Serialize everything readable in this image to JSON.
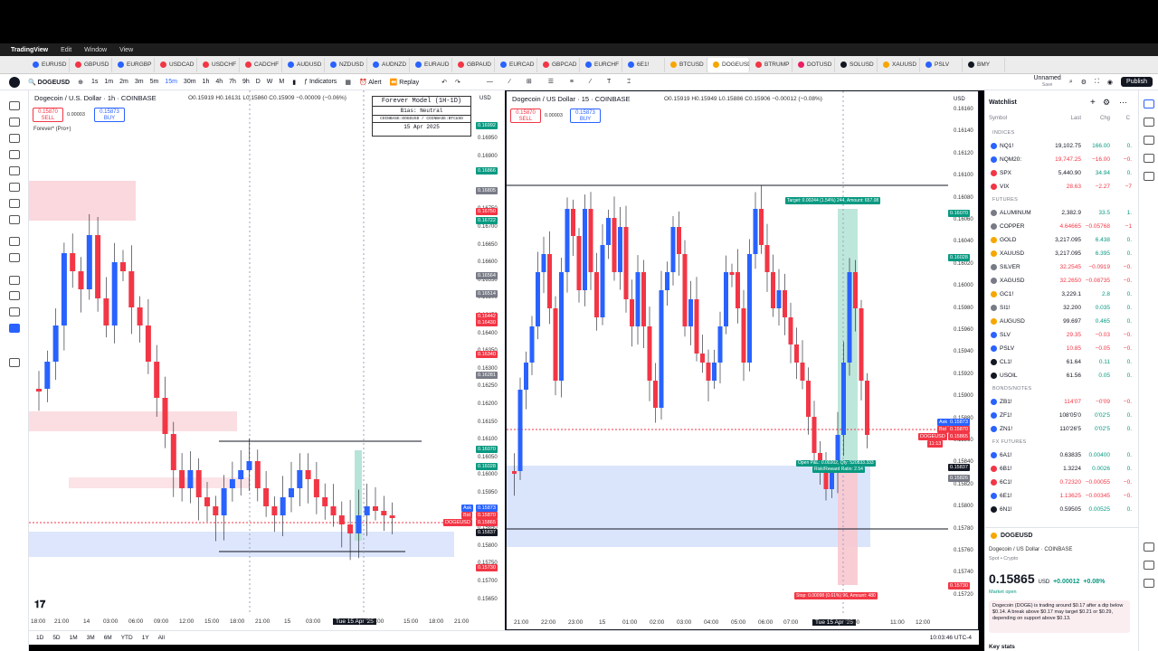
{
  "menubar": {
    "app": "TradingView",
    "items": [
      "Edit",
      "Window",
      "View"
    ]
  },
  "tabs": [
    "EURUSD",
    "GBPUSD",
    "EURGBP",
    "USDCAD",
    "USDCHF",
    "CADCHF",
    "AUDUSD",
    "NZDUSD",
    "AUDNZD",
    "EURAUD",
    "GBPAUD",
    "EURCAD",
    "GBPCAD",
    "EURCHF",
    "6E1!",
    "BTCUSD",
    "DOGEUSD",
    "BTRUMP",
    "DOTUSD",
    "SOLUSD",
    "XAUUSD",
    "PSLV",
    "BMY"
  ],
  "active_tab": "DOG",
  "toolbar": {
    "symbol": "DOGEUSD",
    "intervals": [
      "1s",
      "1m",
      "2m",
      "3m",
      "5m",
      "15m",
      "30m",
      "1h",
      "4h",
      "7h",
      "9h",
      "D",
      "W",
      "M"
    ],
    "selected_interval": "15m",
    "indicators": "Indicators",
    "alert": "Alert",
    "replay": "Replay",
    "layout_name": "Unnamed",
    "layout_sub": "Save",
    "publish": "Publish"
  },
  "left_pane": {
    "title": "Dogecoin / U.S. Dollar · 1h · COINBASE",
    "ohlc": "O0.15919 H0.16131 L0.15860 C0.15909 −0.00009 (−0.06%)",
    "sell_price": "0.15870",
    "sell_label": "SELL",
    "buy_price": "0.15873",
    "buy_label": "BUY",
    "qty": "0.00003",
    "indicator_label": "Forever* (Pro+)",
    "forever_box": {
      "title": "Forever Model (1H-1D)",
      "bias": "Bias: Neutral",
      "pair": "COINBASE:DOGEUSD / COINBASE:BTCUSD",
      "date": "15 Apr 2025"
    },
    "currency": "USD",
    "price_labels": [
      "0.16950",
      "0.16900",
      "0.16850",
      "0.16800",
      "0.16750",
      "0.16700",
      "0.16650",
      "0.16600",
      "0.16550",
      "0.16500",
      "0.16450",
      "0.16400",
      "0.16350",
      "0.16300",
      "0.16250",
      "0.16200",
      "0.16150",
      "0.16100",
      "0.16050",
      "0.16000",
      "0.15950",
      "0.15900",
      "0.15850",
      "0.15800",
      "0.15750",
      "0.15700",
      "0.15650"
    ],
    "price_tags": [
      {
        "text": "0.16992",
        "color": "#089981"
      },
      {
        "text": "0.16866",
        "color": "#089981"
      },
      {
        "text": "0.16805",
        "color": "#787b86"
      },
      {
        "text": "0.16750",
        "color": "#f23645"
      },
      {
        "text": "0.16722",
        "color": "#089981"
      },
      {
        "text": "0.16564",
        "color": "#787b86"
      },
      {
        "text": "0.16514",
        "color": "#787b86"
      },
      {
        "text": "0.16442",
        "color": "#f23645"
      },
      {
        "text": "0.16430",
        "color": "#f23645"
      },
      {
        "text": "0.16340",
        "color": "#f23645"
      },
      {
        "text": "0.16281",
        "color": "#787b86"
      },
      {
        "text": "0.16070",
        "color": "#089981"
      },
      {
        "text": "0.16028",
        "color": "#089981"
      },
      {
        "text": "0.15873",
        "color": "#2962ff"
      },
      {
        "text": "0.15870",
        "color": "#f23645"
      },
      {
        "text": "0.15865",
        "color": "#f23645"
      },
      {
        "text": "0.15837",
        "color": "#131722"
      },
      {
        "text": "0.15730",
        "color": "#f23645"
      }
    ],
    "ask_label": "Ask",
    "bid_label": "Bid",
    "sym_label": "DOGEUSD",
    "time_labels": [
      "18:00",
      "21:00",
      "14",
      "03:00",
      "06:00",
      "09:00",
      "12:00",
      "15:00",
      "18:00",
      "21:00",
      "15",
      "03:00",
      "Tue 15 Apr '25",
      "09:00",
      "15:00",
      "18:00",
      "21:00"
    ]
  },
  "right_pane": {
    "title": "Dogecoin / US Dollar · 15 · COINBASE",
    "ohlc": "O0.15919 H0.15949 L0.15886 C0.15906 −0.00012 (−0.08%)",
    "sell_price": "0.15870",
    "sell_label": "SELL",
    "buy_price": "0.15873",
    "buy_label": "BUY",
    "qty": "0.00003",
    "currency": "USD",
    "price_labels": [
      "0.16160",
      "0.16140",
      "0.16120",
      "0.16100",
      "0.16080",
      "0.16060",
      "0.16040",
      "0.16020",
      "0.16000",
      "0.15980",
      "0.15960",
      "0.15940",
      "0.15920",
      "0.15900",
      "0.15880",
      "0.15860",
      "0.15840",
      "0.15820",
      "0.15800",
      "0.15780",
      "0.15760",
      "0.15740",
      "0.15720"
    ],
    "target_label": "Target: 0.00244 (1.54%) 244, Amount: 657.08",
    "open_label": "Open P&L: 0.00202, Qty: 520833.333",
    "risk_label": "Risk/Reward Ratio: 2.54",
    "stop_label": "Stop: 0.00098 (0.61%) 96, Amount: 480",
    "price_tags": [
      {
        "text": "0.16070",
        "color": "#089981"
      },
      {
        "text": "0.16028",
        "color": "#089981"
      },
      {
        "text": "0.15873",
        "color": "#2962ff"
      },
      {
        "text": "0.15870",
        "color": "#f23645"
      },
      {
        "text": "0.15865",
        "color": "#f23645"
      },
      {
        "text": "0.15837",
        "color": "#131722"
      },
      {
        "text": "0.15826",
        "color": "#787b86"
      },
      {
        "text": "0.15730",
        "color": "#f23645"
      }
    ],
    "ask_label": "Ask",
    "bid_label": "Bid",
    "sym_label": "DOGEUSD",
    "countdown": "11:13",
    "time_labels": [
      "21:00",
      "22:00",
      "23:00",
      "15",
      "01:00",
      "02:00",
      "03:00",
      "04:00",
      "05:00",
      "06:00",
      "07:00",
      "Tue 15 Apr '25",
      "09:00",
      "11:00",
      "12:00"
    ]
  },
  "bottom": {
    "ranges": [
      "1D",
      "5D",
      "1M",
      "3M",
      "6M",
      "YTD",
      "1Y",
      "All"
    ],
    "clock": "10:03:46 UTC-4"
  },
  "watchlist": {
    "title": "Watchlist",
    "headers": {
      "symbol": "Symbol",
      "last": "Last",
      "chg": "Chg",
      "pct": "C"
    },
    "sections": [
      {
        "name": "INDICES",
        "rows": [
          {
            "sym": "NQ1!",
            "last": "19,102.75",
            "chg": "166.00",
            "pct": "0.",
            "dir": "up",
            "color": "#2962ff"
          },
          {
            "sym": "NQM20:",
            "last": "19,747.25",
            "chg": "−16.00",
            "pct": "−0.",
            "dir": "down",
            "color": "#2962ff"
          },
          {
            "sym": "SPX",
            "last": "5,440.90",
            "chg": "34.94",
            "pct": "0.",
            "dir": "up",
            "color": "#f23645"
          },
          {
            "sym": "VIX",
            "last": "28.63",
            "chg": "−2.27",
            "pct": "−7",
            "dir": "down",
            "color": "#f23645"
          }
        ]
      },
      {
        "name": "FUTURES",
        "rows": [
          {
            "sym": "ALUMINUM",
            "last": "2,382.9",
            "chg": "33.5",
            "pct": "1.",
            "dir": "up",
            "color": "#787b86"
          },
          {
            "sym": "COPPER",
            "last": "4.64665",
            "chg": "−0.05768",
            "pct": "−1",
            "dir": "down",
            "color": "#787b86"
          },
          {
            "sym": "GOLD",
            "last": "3,217.095",
            "chg": "6.438",
            "pct": "0.",
            "dir": "up",
            "color": "#f7a600"
          },
          {
            "sym": "XAUUSD",
            "last": "3,217.095",
            "chg": "6.395",
            "pct": "0.",
            "dir": "up",
            "color": "#f7a600"
          },
          {
            "sym": "SILVER",
            "last": "32.2545",
            "chg": "−0.0919",
            "pct": "−0.",
            "dir": "down",
            "color": "#787b86"
          },
          {
            "sym": "XAGUSD",
            "last": "32.2650",
            "chg": "−0.08735",
            "pct": "−0.",
            "dir": "down",
            "color": "#787b86"
          },
          {
            "sym": "GC1!",
            "last": "3,229.1",
            "chg": "2.8",
            "pct": "0.",
            "dir": "up",
            "color": "#f7a600"
          },
          {
            "sym": "SI1!",
            "last": "32.200",
            "chg": "0.035",
            "pct": "0.",
            "dir": "up",
            "color": "#787b86"
          },
          {
            "sym": "AUGUSD",
            "last": "99.697",
            "chg": "0.465",
            "pct": "0.",
            "dir": "up",
            "color": "#f7a600"
          },
          {
            "sym": "SLV",
            "last": "29.35",
            "chg": "−0.03",
            "pct": "−0.",
            "dir": "down",
            "color": "#2962ff"
          },
          {
            "sym": "PSLV",
            "last": "10.85",
            "chg": "−0.05",
            "pct": "−0.",
            "dir": "down",
            "color": "#2962ff"
          },
          {
            "sym": "CL1!",
            "last": "61.64",
            "chg": "0.11",
            "pct": "0.",
            "dir": "up",
            "color": "#131722"
          },
          {
            "sym": "USOIL",
            "last": "61.56",
            "chg": "0.05",
            "pct": "0.",
            "dir": "up",
            "color": "#131722"
          }
        ]
      },
      {
        "name": "BONDS/NOTES",
        "rows": [
          {
            "sym": "ZB1!",
            "last": "114'07",
            "chg": "−0'09",
            "pct": "−0.",
            "dir": "down",
            "color": "#2962ff"
          },
          {
            "sym": "ZF1!",
            "last": "108'05'0",
            "chg": "0'02'5",
            "pct": "0.",
            "dir": "up",
            "color": "#2962ff"
          },
          {
            "sym": "ZN1!",
            "last": "110'26'5",
            "chg": "0'02'5",
            "pct": "0.",
            "dir": "up",
            "color": "#2962ff"
          }
        ]
      },
      {
        "name": "FX FUTURES",
        "rows": [
          {
            "sym": "6A1!",
            "last": "0.63835",
            "chg": "0.00400",
            "pct": "0.",
            "dir": "up",
            "color": "#2962ff"
          },
          {
            "sym": "6B1!",
            "last": "1.3224",
            "chg": "0.0026",
            "pct": "0.",
            "dir": "up",
            "color": "#f23645"
          },
          {
            "sym": "6C1!",
            "last": "0.72320",
            "chg": "−0.00055",
            "pct": "−0.",
            "dir": "down",
            "color": "#f23645"
          },
          {
            "sym": "6E1!",
            "last": "1.13625",
            "chg": "−0.00345",
            "pct": "−0.",
            "dir": "down",
            "color": "#2962ff"
          },
          {
            "sym": "6N1!",
            "last": "0.59505",
            "chg": "0.00525",
            "pct": "0.",
            "dir": "up",
            "color": "#131722"
          }
        ]
      }
    ],
    "detail": {
      "symbol": "DOGEUSD",
      "name": "Dogecoin / US Dollar",
      "exchange": "COINBASE",
      "type": "Spot • Crypto",
      "price": "0.15865",
      "currency": "USD",
      "change": "+0.00012",
      "change_pct": "+0.08%",
      "status": "Market open",
      "news": "Dogecoin (DOGE) is trading around $0.17 after a dip below $0.14. A break above $0.17 may target $0.21 or $0.29, depending on support above $0.13.",
      "key_stats": "Key stats"
    }
  },
  "colors": {
    "up": "#2962ff",
    "down": "#f23645",
    "profit": "#089981",
    "accent": "#2962ff"
  }
}
